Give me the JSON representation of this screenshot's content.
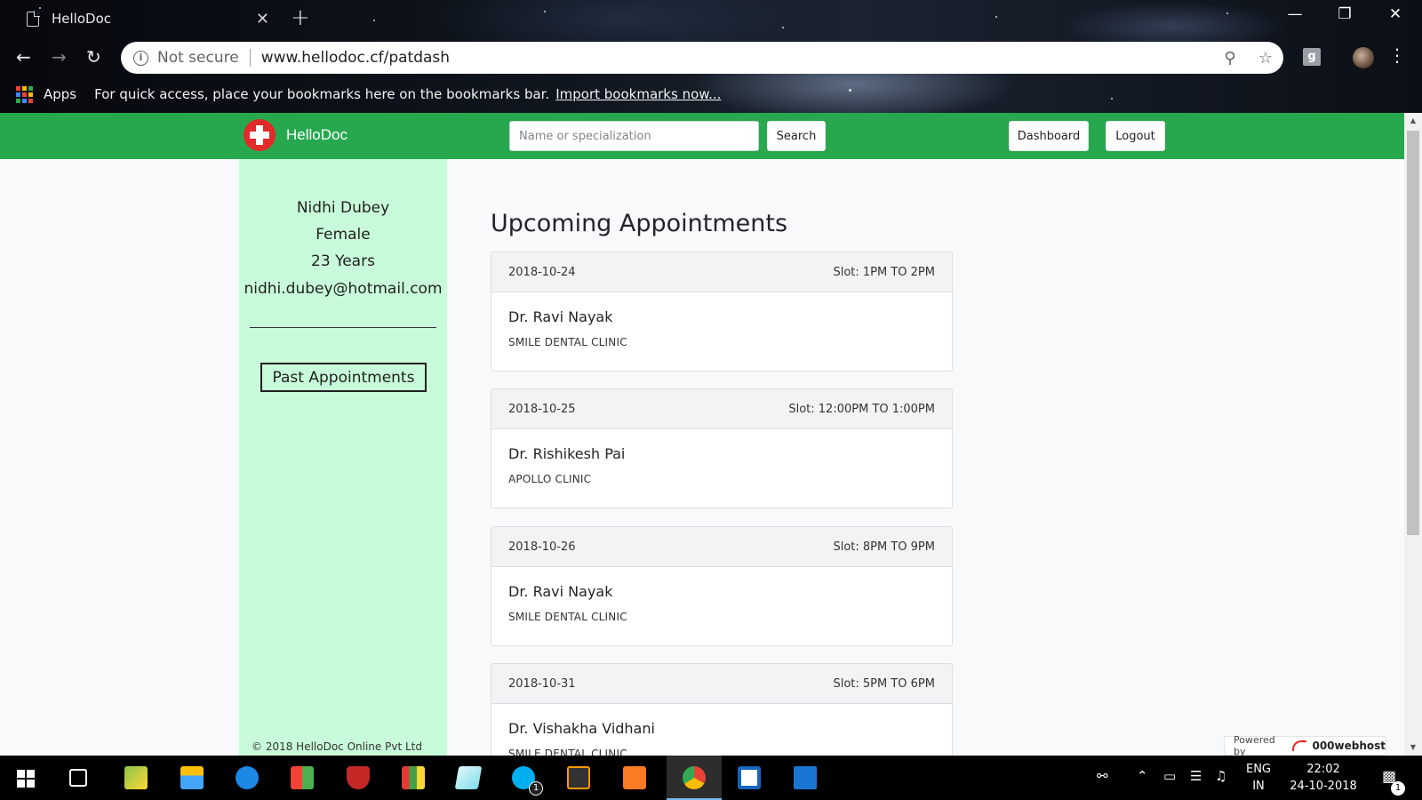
{
  "browser": {
    "tab_title": "HelloDoc",
    "tab_close": "✕",
    "new_tab": "+",
    "not_secure": "Not secure",
    "url": "www.hellodoc.cf/patdash",
    "bookmarks_apps": "Apps",
    "bookmarks_hint": "For quick access, place your bookmarks here on the bookmarks bar.",
    "bookmarks_link": "Import bookmarks now..."
  },
  "navbar": {
    "brand": "HelloDoc",
    "search_placeholder": "Name or specialization",
    "search_label": "Search",
    "dashboard_label": "Dashboard",
    "logout_label": "Logout",
    "brand_color": "#27a84f",
    "logo_color": "#e12a2a"
  },
  "profile": {
    "name": "Nidhi Dubey",
    "gender": "Female",
    "age": "23 Years",
    "email": "nidhi.dubey@hotmail.com",
    "past_label": "Past Appointments",
    "sidebar_color": "#c8fbd9"
  },
  "main": {
    "title": "Upcoming Appointments",
    "appointments": [
      {
        "date": "2018-10-24",
        "slot": "Slot: 1PM TO 2PM",
        "doctor": "Dr. Ravi Nayak",
        "clinic": "SMILE DENTAL CLINIC"
      },
      {
        "date": "2018-10-25",
        "slot": "Slot: 12:00PM TO 1:00PM",
        "doctor": "Dr. Rishikesh Pai",
        "clinic": "APOLLO CLINIC"
      },
      {
        "date": "2018-10-26",
        "slot": "Slot: 8PM TO 9PM",
        "doctor": "Dr. Ravi Nayak",
        "clinic": "SMILE DENTAL CLINIC"
      },
      {
        "date": "2018-10-31",
        "slot": "Slot: 5PM TO 6PM",
        "doctor": "Dr. Vishakha Vidhani",
        "clinic": "SMILE DENTAL CLINIC"
      }
    ]
  },
  "footer": {
    "copyright": "© 2018 HelloDoc Online Pvt Ltd",
    "powered_by": "Powered by",
    "host": "000webhost"
  },
  "taskbar": {
    "lang_top": "ENG",
    "lang_bottom": "IN",
    "time": "22:02",
    "date": "24-10-2018",
    "skype_badge": "1",
    "notif_badge": "1"
  }
}
